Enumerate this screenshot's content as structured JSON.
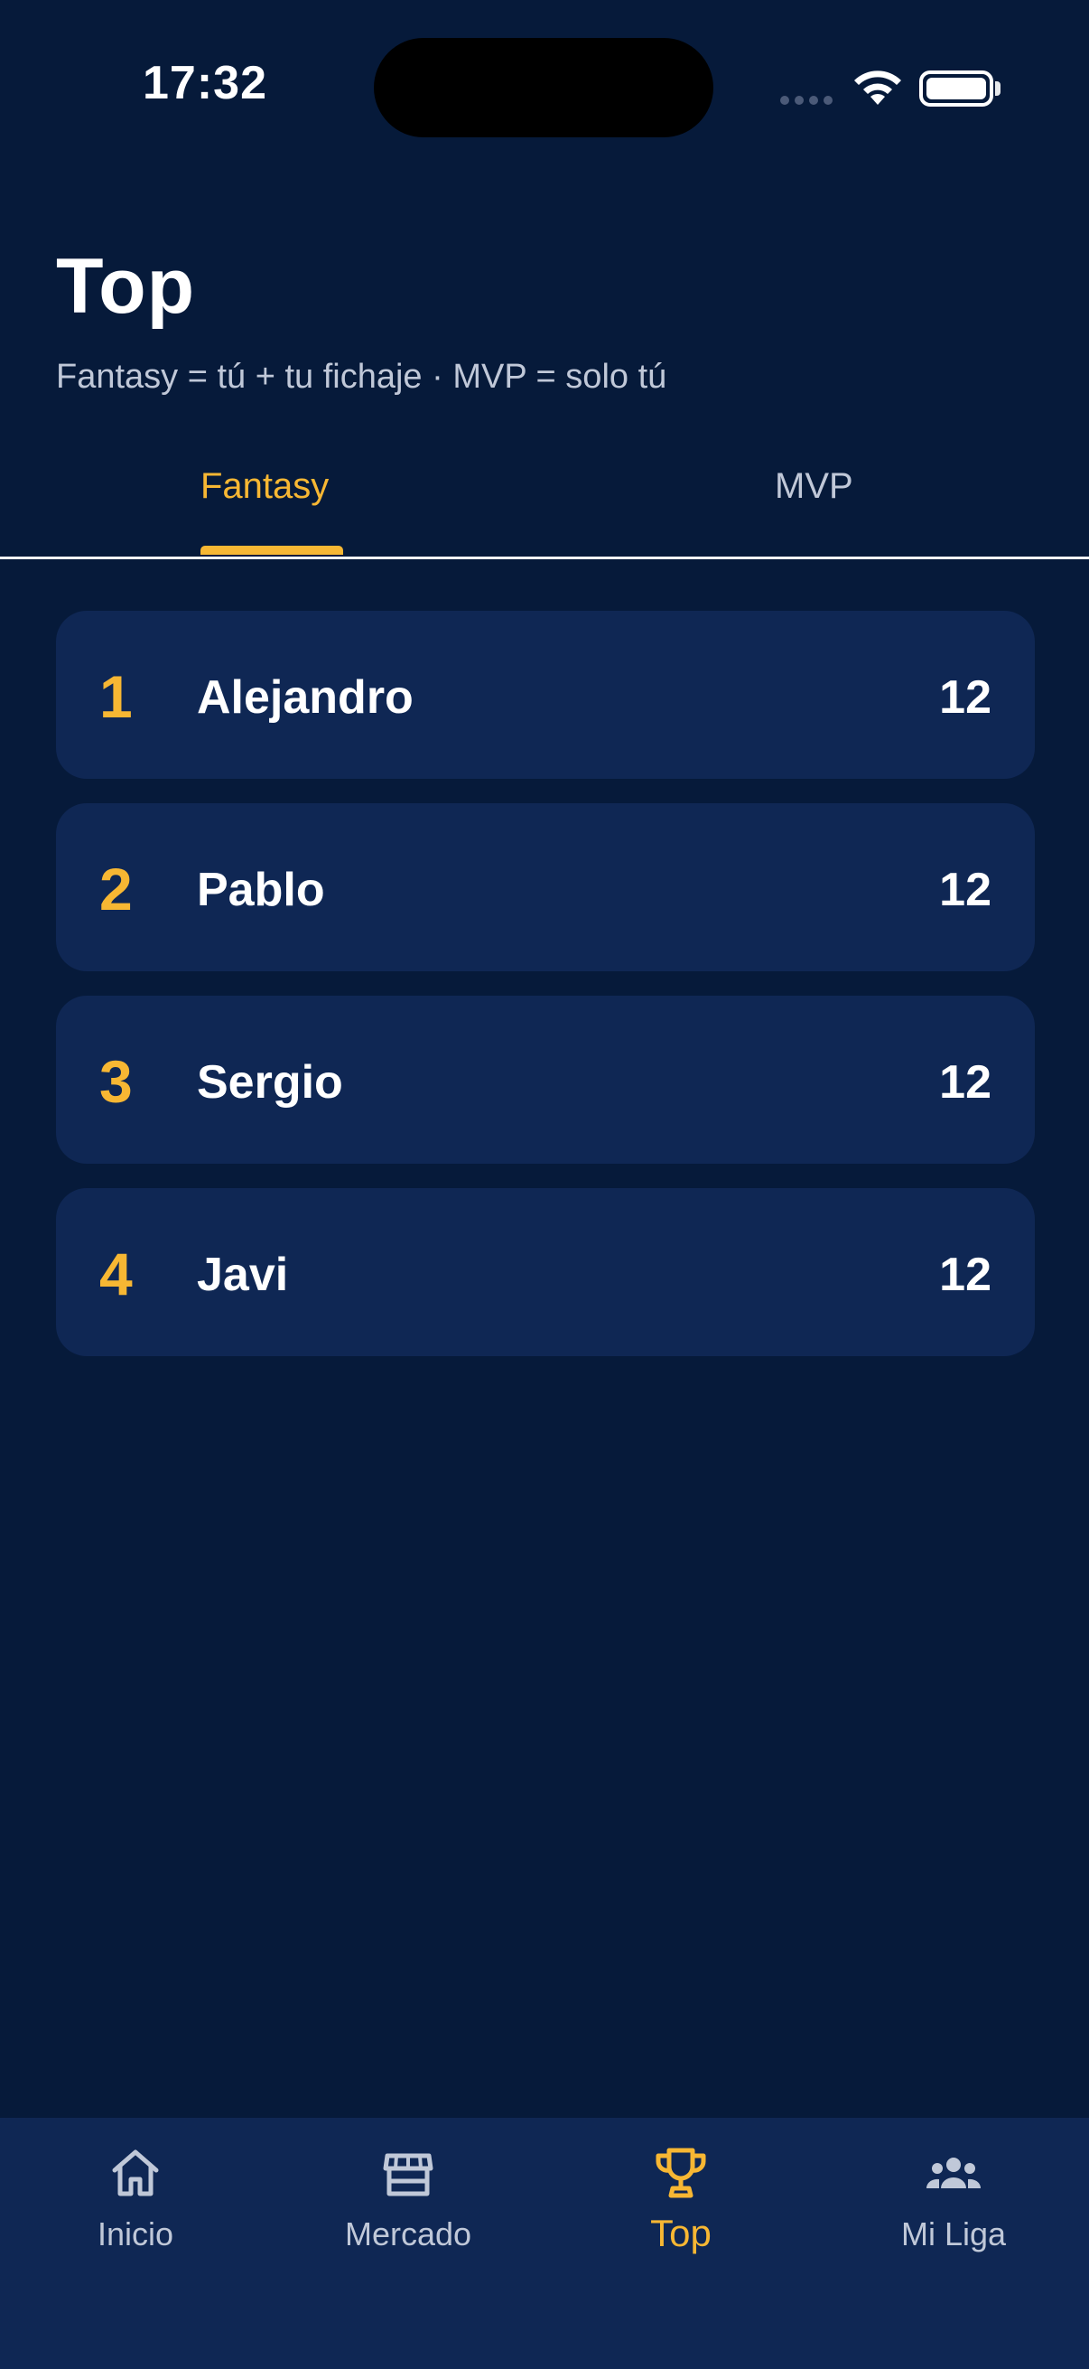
{
  "status_bar": {
    "time": "17:32",
    "icons": [
      "signal-dots-icon",
      "wifi-icon",
      "battery-icon"
    ]
  },
  "header": {
    "title": "Top",
    "subtitle": "Fantasy = tú + tu fichaje · MVP = solo tú"
  },
  "tabs": [
    {
      "label": "Fantasy",
      "active": true
    },
    {
      "label": "MVP",
      "active": false
    }
  ],
  "leaderboard": [
    {
      "rank": "1",
      "name": "Alejandro",
      "points": "12"
    },
    {
      "rank": "2",
      "name": "Pablo",
      "points": "12"
    },
    {
      "rank": "3",
      "name": "Sergio",
      "points": "12"
    },
    {
      "rank": "4",
      "name": "Javi",
      "points": "12"
    }
  ],
  "bottom_nav": [
    {
      "label": "Inicio",
      "icon": "home-icon",
      "active": false
    },
    {
      "label": "Mercado",
      "icon": "store-icon",
      "active": false
    },
    {
      "label": "Top",
      "icon": "trophy-icon",
      "active": true
    },
    {
      "label": "Mi Liga",
      "icon": "group-icon",
      "active": false
    }
  ],
  "colors": {
    "background": "#061a3a",
    "card": "#0f2754",
    "accent": "#f7b733",
    "muted_text": "#c0c8d8",
    "text": "#ffffff"
  }
}
